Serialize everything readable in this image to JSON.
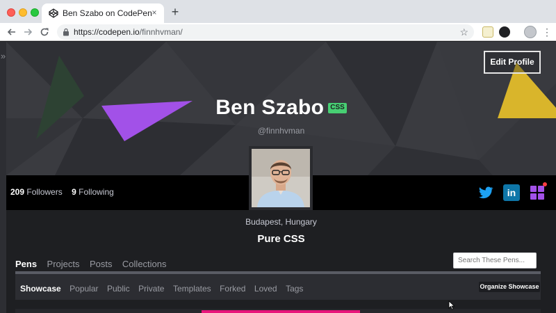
{
  "browser": {
    "tab_title": "Ben Szabo on CodePen",
    "tab_close": "×",
    "new_tab": "+",
    "url_host": "https://codepen.io",
    "url_path": "/finnhvman/",
    "icons": [
      "codepen-favicon",
      "back-arrow-icon",
      "forward-arrow-icon",
      "reload-icon",
      "lock-icon",
      "star-icon",
      "extension-icon",
      "profile-icon",
      "menu-icon"
    ]
  },
  "profile": {
    "edit_label": "Edit Profile",
    "name": "Ben Szabo",
    "badge": "CSS",
    "handle": "@finnhvman",
    "followers_count": "209",
    "followers_label": "Followers",
    "following_count": "9",
    "following_label": "Following",
    "location": "Budapest, Hungary",
    "bio": "Pure CSS",
    "linkedin_glyph": "in"
  },
  "tabs": [
    {
      "label": "Pens",
      "active": true
    },
    {
      "label": "Projects",
      "active": false
    },
    {
      "label": "Posts",
      "active": false
    },
    {
      "label": "Collections",
      "active": false
    }
  ],
  "search": {
    "placeholder": "Search These Pens..."
  },
  "subnav": [
    {
      "label": "Showcase",
      "active": true
    },
    {
      "label": "Popular",
      "active": false
    },
    {
      "label": "Public",
      "active": false
    },
    {
      "label": "Private",
      "active": false
    },
    {
      "label": "Templates",
      "active": false
    },
    {
      "label": "Forked",
      "active": false
    },
    {
      "label": "Loved",
      "active": false
    },
    {
      "label": "Tags",
      "active": false
    }
  ],
  "organize_label": "Organize Showcase",
  "colors": {
    "accent_green": "#47cf73",
    "twitter_blue": "#1da1f2",
    "linkedin_blue": "#0e76a8",
    "pen_preview_pink": "#e8157b",
    "purple_triangle": "#a251e8",
    "yellow_triangle": "#d9b52b"
  }
}
